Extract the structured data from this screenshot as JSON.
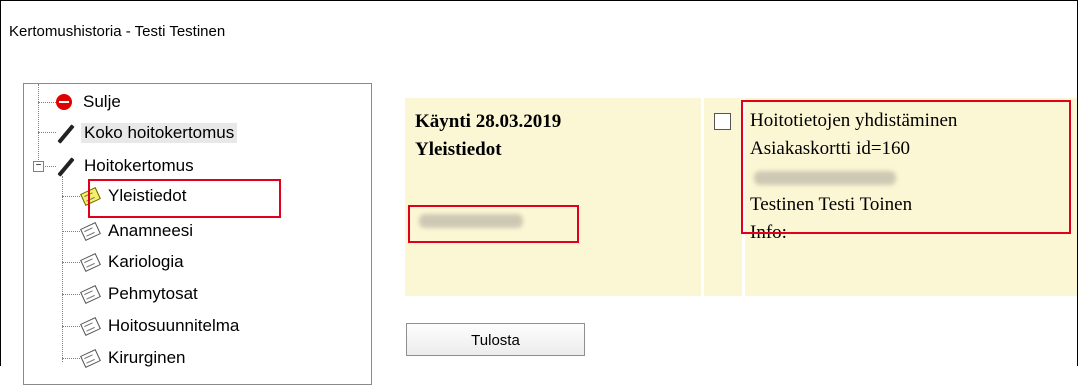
{
  "window": {
    "title": "Kertomushistoria  -  Testi Testinen"
  },
  "tree": {
    "items": [
      {
        "label": "Sulje",
        "icon": "stop-icon"
      },
      {
        "label": "Koko hoitokertomus",
        "icon": "pen-icon"
      },
      {
        "label": "Hoitokertomus",
        "icon": "pen-icon"
      },
      {
        "label": "Yleistiedot",
        "icon": "note-icon",
        "selected": true
      },
      {
        "label": "Anamneesi",
        "icon": "note-icon"
      },
      {
        "label": "Kariologia",
        "icon": "note-icon"
      },
      {
        "label": "Pehmytosat",
        "icon": "note-icon"
      },
      {
        "label": "Hoitosuunnitelma",
        "icon": "note-icon"
      },
      {
        "label": "Kirurginen",
        "icon": "note-icon"
      }
    ]
  },
  "visit": {
    "title": "Käynti 28.03.2019",
    "subtitle": "Yleistiedot"
  },
  "details": {
    "line1": "Hoitotietojen yhdistäminen",
    "line2": "Asiakaskortti id=160",
    "line4": "Testinen Testi Toinen",
    "line5": "Info:"
  },
  "actions": {
    "print_label": "Tulosta"
  },
  "colors": {
    "panel_bg": "#fbf6d4",
    "highlight": "#e0001b"
  }
}
